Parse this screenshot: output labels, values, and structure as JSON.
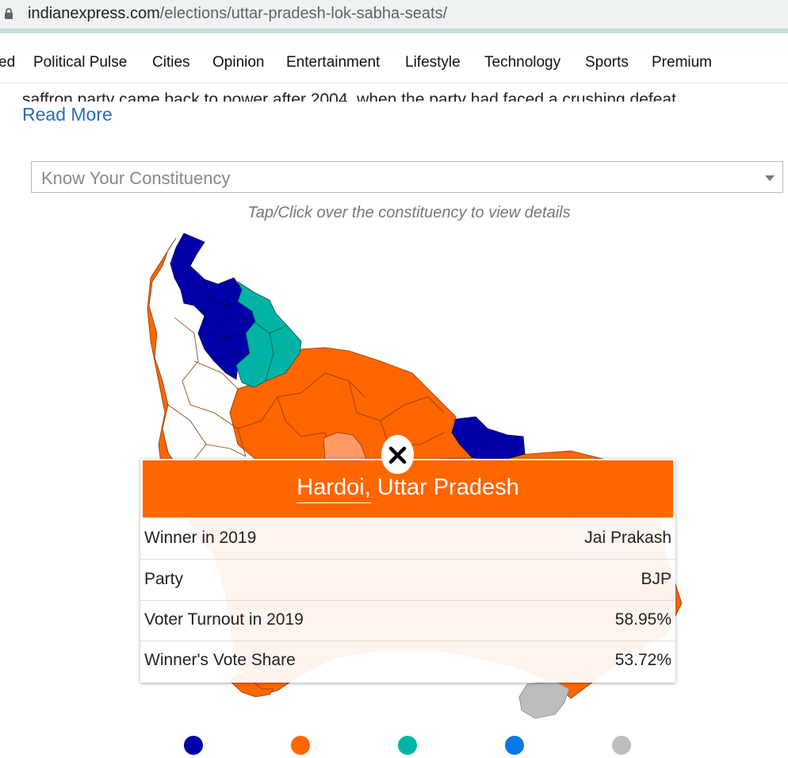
{
  "browser": {
    "url_host": "indianexpress.com",
    "url_path": "/elections/uttar-pradesh-lok-sabha-seats/"
  },
  "nav": {
    "items": [
      "ed",
      "Political Pulse",
      "Cities",
      "Opinion",
      "Entertainment",
      "Lifestyle",
      "Technology",
      "Sports",
      "Premium"
    ]
  },
  "article": {
    "text_line": "saffron party came back to power after 2004, when the party had faced a crushing defeat",
    "read_more": "Read More"
  },
  "constituency_select": {
    "placeholder": "Know Your Constituency"
  },
  "map_hint": "Tap/Click over the constituency to view details",
  "popup": {
    "place": "Hardoi,",
    "state": " Uttar Pradesh",
    "close_icon": "close-icon",
    "rows": [
      {
        "label": "Winner in 2019",
        "value": "Jai Prakash"
      },
      {
        "label": "Party",
        "value": "BJP"
      },
      {
        "label": "Voter Turnout in 2019",
        "value": "58.95%"
      },
      {
        "label": "Winner's Vote Share",
        "value": "53.72%"
      }
    ]
  },
  "colors": {
    "bjp_orange": "#ff6600",
    "bsp_navy": "#0000a8",
    "sp_teal": "#00b3a4",
    "blue": "#0a78e6",
    "grey": "#bdbdbd",
    "highlight": "#ff9a66"
  },
  "legend": [
    "#0000a8",
    "#ff6600",
    "#00b3a4",
    "#0a78e6",
    "#bdbdbd"
  ]
}
